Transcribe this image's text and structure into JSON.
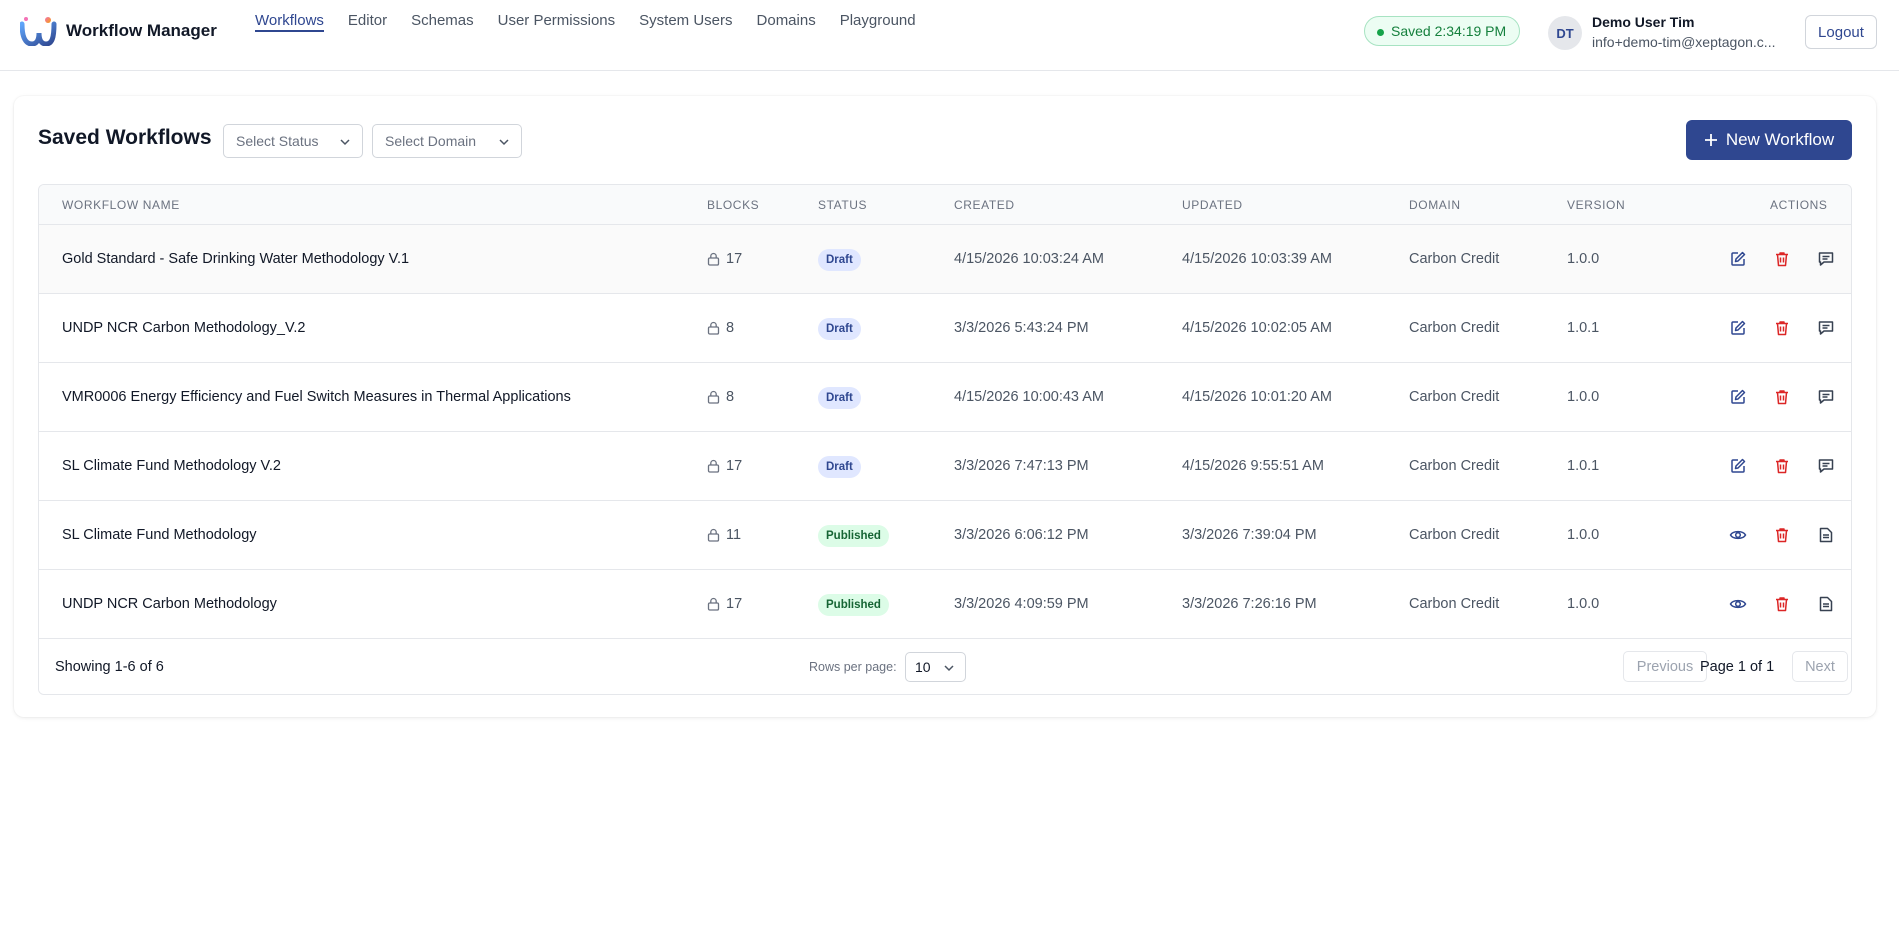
{
  "app": {
    "brand": "Workflow Manager",
    "logo_icon": "wj-logo-icon"
  },
  "nav": {
    "items": [
      {
        "label": "Workflows",
        "active": true
      },
      {
        "label": "Editor"
      },
      {
        "label": "Schemas"
      },
      {
        "label": "User Permissions"
      },
      {
        "label": "System Users"
      },
      {
        "label": "Domains"
      },
      {
        "label": "Playground"
      }
    ]
  },
  "status": {
    "saved_text": "Saved 2:34:19 PM"
  },
  "user": {
    "initials": "DT",
    "name": "Demo User Tim",
    "email": "info+demo-tim@xeptagon.c...",
    "logout_label": "Logout"
  },
  "page": {
    "title": "Saved Workflows",
    "status_filter_placeholder": "Select Status",
    "domain_filter_placeholder": "Select Domain",
    "new_button_label": "New Workflow"
  },
  "table": {
    "headers": {
      "name": "WORKFLOW NAME",
      "blocks": "BLOCKS",
      "status": "STATUS",
      "created": "CREATED",
      "updated": "UPDATED",
      "domain": "DOMAIN",
      "version": "VERSION",
      "actions": "ACTIONS"
    },
    "rows": [
      {
        "name": "Gold Standard - Safe Drinking Water Methodology V.1",
        "blocks": "17",
        "status": "Draft",
        "created": "4/15/2026 10:03:24 AM",
        "updated": "4/15/2026 10:03:39 AM",
        "domain": "Carbon Credit",
        "version": "1.0.0"
      },
      {
        "name": "UNDP NCR Carbon Methodology_V.2",
        "blocks": "8",
        "status": "Draft",
        "created": "3/3/2026 5:43:24 PM",
        "updated": "4/15/2026 10:02:05 AM",
        "domain": "Carbon Credit",
        "version": "1.0.1"
      },
      {
        "name": "VMR0006 Energy Efficiency and Fuel Switch Measures in Thermal Applications",
        "blocks": "8",
        "status": "Draft",
        "created": "4/15/2026 10:00:43 AM",
        "updated": "4/15/2026 10:01:20 AM",
        "domain": "Carbon Credit",
        "version": "1.0.0"
      },
      {
        "name": "SL Climate Fund Methodology V.2",
        "blocks": "17",
        "status": "Draft",
        "created": "3/3/2026 7:47:13 PM",
        "updated": "4/15/2026 9:55:51 AM",
        "domain": "Carbon Credit",
        "version": "1.0.1"
      },
      {
        "name": "SL Climate Fund Methodology",
        "blocks": "11",
        "status": "Published",
        "created": "3/3/2026 6:06:12 PM",
        "updated": "3/3/2026 7:39:04 PM",
        "domain": "Carbon Credit",
        "version": "1.0.0"
      },
      {
        "name": "UNDP NCR Carbon Methodology",
        "blocks": "17",
        "status": "Published",
        "created": "3/3/2026 4:09:59 PM",
        "updated": "3/3/2026 7:26:16 PM",
        "domain": "Carbon Credit",
        "version": "1.0.0"
      }
    ]
  },
  "pagination": {
    "showing": "Showing 1-6 of 6",
    "rows_per_page_label": "Rows per page:",
    "rows_per_page_value": "10",
    "previous_label": "Previous",
    "page_text": "Page 1 of 1",
    "next_label": "Next"
  },
  "colors": {
    "primary": "#2f4790",
    "danger": "#dc2626",
    "success": "#16a34a"
  }
}
